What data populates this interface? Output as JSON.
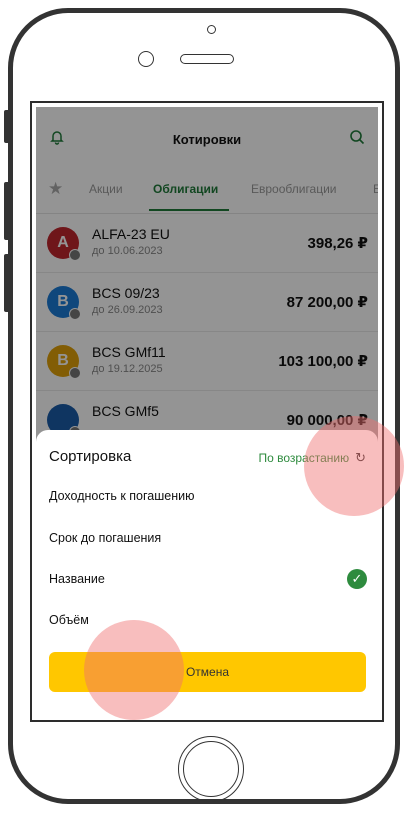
{
  "header": {
    "title": "Котировки"
  },
  "tabs": [
    {
      "label": "Акции"
    },
    {
      "label": "Облигации",
      "active": true
    },
    {
      "label": "Еврооблигации"
    },
    {
      "label": "ET"
    }
  ],
  "quotes": [
    {
      "avatar_letter": "A",
      "name": "ALFA-23 EU",
      "date": "до 10.06.2023",
      "price": "398,26 ₽",
      "color": "#c0262d"
    },
    {
      "avatar_letter": "B",
      "name": "BCS 09/23",
      "date": "до 26.09.2023",
      "price": "87 200,00 ₽",
      "color": "#1a7ad6"
    },
    {
      "avatar_letter": "B",
      "name": "BCS GMf11",
      "date": "до 19.12.2025",
      "price": "103 100,00 ₽",
      "color": "#e0a10a"
    },
    {
      "avatar_letter": "",
      "name": "BCS GMf5",
      "date": "",
      "price": "90 000,00 ₽",
      "color": "#1a5ca8"
    }
  ],
  "sort_sheet": {
    "title": "Сортировка",
    "order_label": "По возрастанию",
    "options": [
      {
        "label": "Доходность к погашению",
        "selected": false
      },
      {
        "label": "Срок до погашения",
        "selected": false
      },
      {
        "label": "Название",
        "selected": true
      },
      {
        "label": "Объём",
        "selected": false
      }
    ],
    "cancel_label": "Отмена"
  },
  "icons": {
    "bell": "bell-icon",
    "search": "search-icon",
    "star": "star-icon",
    "refresh": "refresh-icon",
    "check": "check-icon"
  },
  "colors": {
    "accent": "#2e8b3e",
    "button": "#ffc700"
  }
}
